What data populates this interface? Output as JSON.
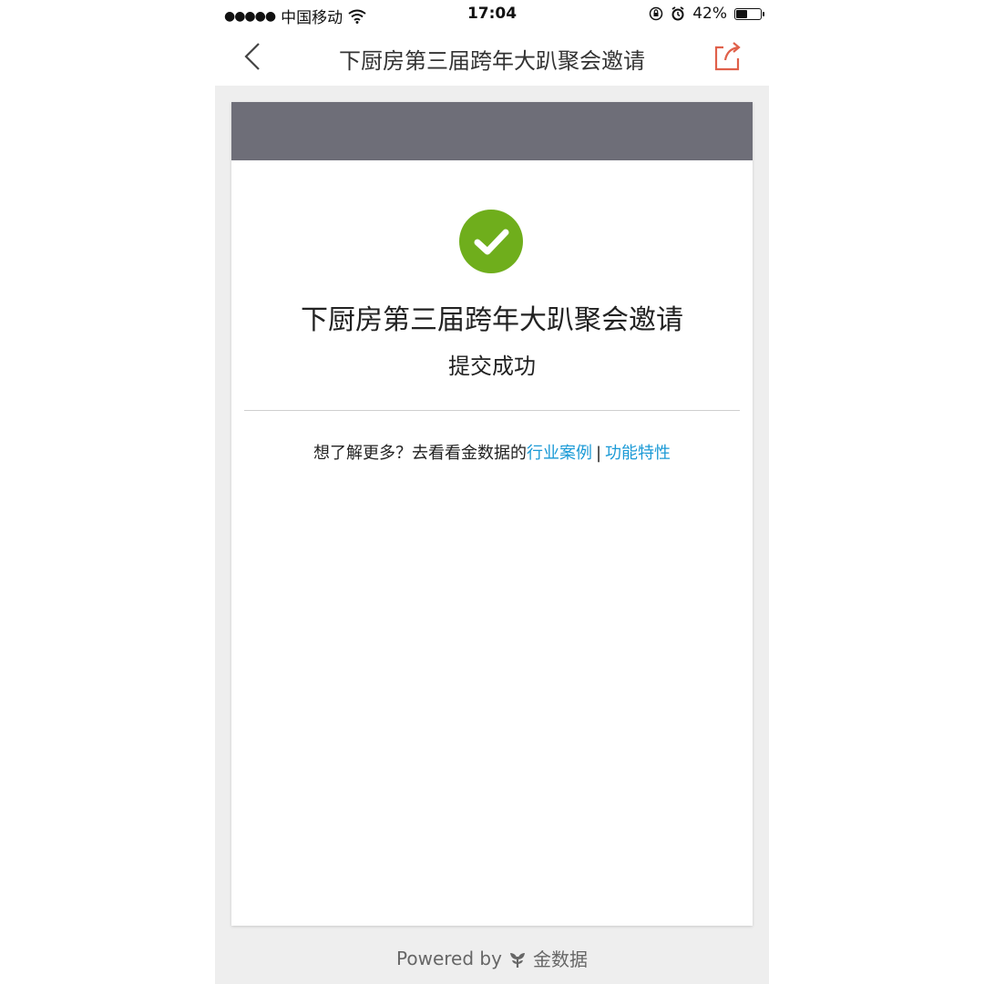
{
  "status_bar": {
    "signal_dots": "●●●●●",
    "carrier": "中国移动",
    "time": "17:04",
    "battery_percent": "42%",
    "battery_level": 0.42
  },
  "nav": {
    "title": "下厨房第三届跨年大趴聚会邀请"
  },
  "card": {
    "header_color": "#6e6e78",
    "title": "下厨房第三届跨年大趴聚会邀请",
    "subtitle": "提交成功",
    "more_prefix": "想了解更多？去看看金数据的",
    "link_cases": "行业案例",
    "separator": "|",
    "link_features": "功能特性"
  },
  "footer": {
    "powered_by": "Powered by",
    "brand": "金数据"
  },
  "colors": {
    "success": "#6fae1c",
    "link": "#1b9ad6",
    "share_icon": "#e0604a",
    "background": "#eeeeee"
  }
}
